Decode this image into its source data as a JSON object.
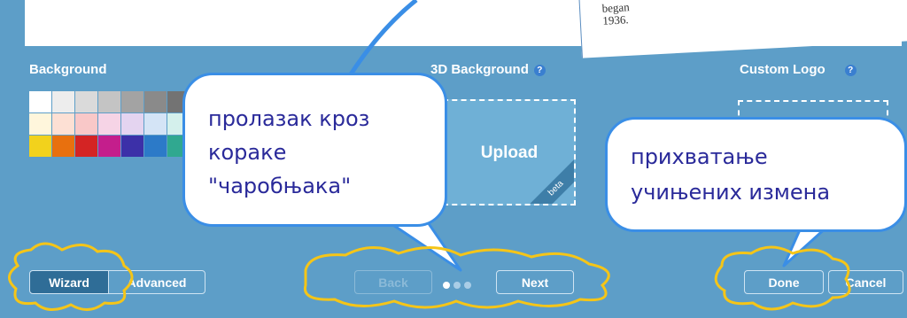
{
  "doc_preview": {
    "line1": "began",
    "line2": "1936."
  },
  "sections": {
    "background": "Background",
    "bg3d": "3D Background",
    "custom_logo": "Custom Logo",
    "help_glyph": "?"
  },
  "swatch_colors": [
    "#ffffff",
    "#ededed",
    "#dadada",
    "#c4c4c4",
    "#a3a3a3",
    "#8a8a8a",
    "#737373",
    "#fff6dc",
    "#fde0d4",
    "#f9c8c8",
    "#f6d4e6",
    "#e4d4f0",
    "#d4e4f6",
    "#d4f0ec",
    "#f2d21c",
    "#e8700e",
    "#d42424",
    "#c41e8c",
    "#3c30a8",
    "#2c7ac8",
    "#30a890"
  ],
  "upload": {
    "label": "Upload",
    "badge": "beta"
  },
  "footer": {
    "wizard": "Wizard",
    "advanced": "Advanced",
    "back": "Back",
    "next": "Next",
    "done": "Done",
    "cancel": "Cancel"
  },
  "annotations": {
    "wizard_steps": {
      "line1": "пролазак кроз",
      "line2": "кораке",
      "line3": "\"чаробњака\""
    },
    "accept_changes": {
      "line1": "прихватање",
      "line2": "учињених измена"
    }
  },
  "colors": {
    "panel": "#5d9ec8",
    "bubble_border": "#3a8ee6",
    "highlight": "#f5c518",
    "annotation_text": "#2a2a9a"
  }
}
